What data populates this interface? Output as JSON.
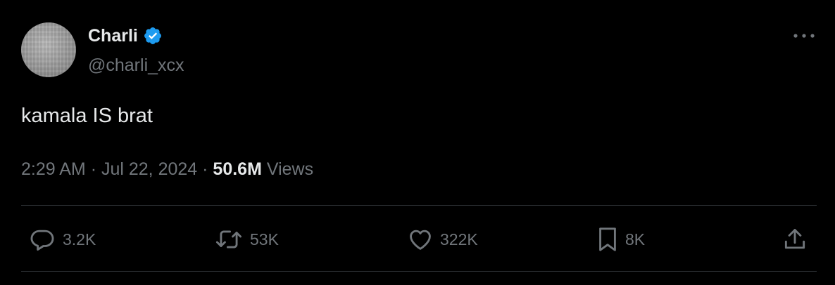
{
  "author": {
    "display_name": "Charli",
    "handle": "@charli_xcx",
    "verified_icon": "verified-badge-icon",
    "verified_color": "#1d9bf0"
  },
  "tweet": {
    "text": "kamala IS brat",
    "time": "2:29 AM",
    "separator": "·",
    "date": "Jul 22, 2024",
    "views_count": "50.6M",
    "views_label": "Views"
  },
  "actions": {
    "replies": "3.2K",
    "reposts": "53K",
    "likes": "322K",
    "bookmarks": "8K"
  },
  "icons": {
    "more": "more-options-icon",
    "reply": "reply-icon",
    "repost": "repost-icon",
    "like": "heart-icon",
    "bookmark": "bookmark-icon",
    "share": "share-icon"
  },
  "colors": {
    "background": "#000000",
    "text_primary": "#e7e9ea",
    "text_secondary": "#71767b",
    "divider": "#2f3336"
  }
}
